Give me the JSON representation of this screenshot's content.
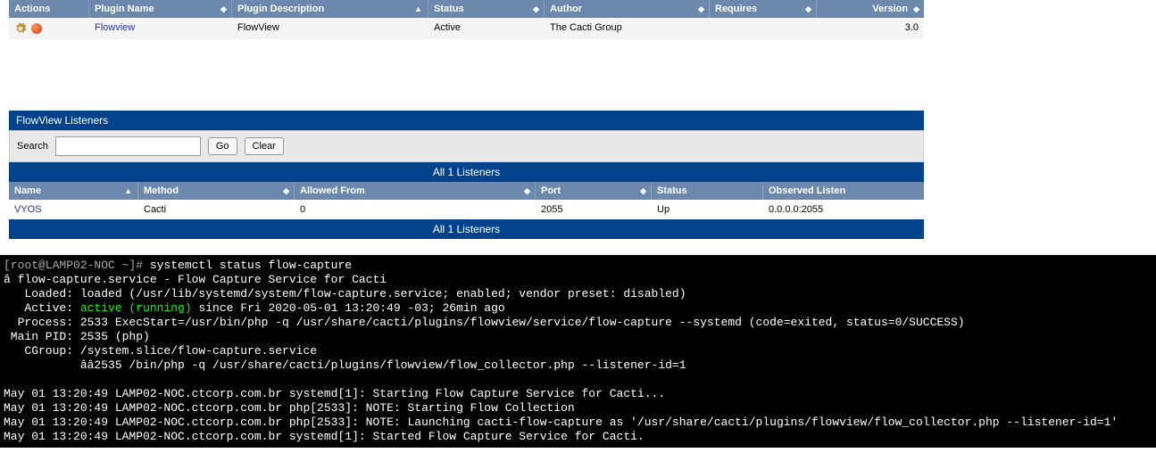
{
  "plugins": {
    "headers": {
      "actions": "Actions",
      "name": "Plugin Name",
      "desc": "Plugin Description",
      "status": "Status",
      "author": "Author",
      "requires": "Requires",
      "version": "Version"
    },
    "row": {
      "name": "Flowview",
      "desc": "FlowView",
      "status": "Active",
      "author": "The Cacti Group",
      "requires": "",
      "version": "3.0"
    }
  },
  "listeners": {
    "title": "FlowView Listeners",
    "search_label": "Search",
    "go": "Go",
    "clear": "Clear",
    "band": "All 1 Listeners",
    "headers": {
      "name": "Name",
      "method": "Method",
      "allowed": "Allowed From",
      "port": "Port",
      "status": "Status",
      "observed": "Observed Listen"
    },
    "row": {
      "name": "VYOS",
      "method": "Cacti",
      "allowed": "0",
      "port": "2055",
      "status": "Up",
      "observed": "0.0.0.0:2055"
    }
  },
  "terminal": {
    "l1a": "[root@LAMP02-NOC ~]# ",
    "l1b": "systemctl status flow-capture",
    "l2": "â flow-capture.service - Flow Capture Service for Cacti",
    "l3": "   Loaded: loaded (/usr/lib/systemd/system/flow-capture.service; enabled; vendor preset: disabled)",
    "l4a": "   Active: ",
    "l4b": "active (running)",
    "l4c": " since Fri 2020-05-01 13:20:49 -03; 26min ago",
    "l5": "  Process: 2533 ExecStart=/usr/bin/php -q /usr/share/cacti/plugins/flowview/service/flow-capture --systemd (code=exited, status=0/SUCCESS)",
    "l6": " Main PID: 2535 (php)",
    "l7": "   CGroup: /system.slice/flow-capture.service",
    "l8": "           ââ2535 /bin/php -q /usr/share/cacti/plugins/flowview/flow_collector.php --listener-id=1",
    "l9": "",
    "l10": "May 01 13:20:49 LAMP02-NOC.ctcorp.com.br systemd[1]: Starting Flow Capture Service for Cacti...",
    "l11": "May 01 13:20:49 LAMP02-NOC.ctcorp.com.br php[2533]: NOTE: Starting Flow Collection",
    "l12": "May 01 13:20:49 LAMP02-NOC.ctcorp.com.br php[2533]: NOTE: Launching cacti-flow-capture as '/usr/share/cacti/plugins/flowview/flow_collector.php --listener-id=1'",
    "l13": "May 01 13:20:49 LAMP02-NOC.ctcorp.com.br systemd[1]: Started Flow Capture Service for Cacti."
  }
}
